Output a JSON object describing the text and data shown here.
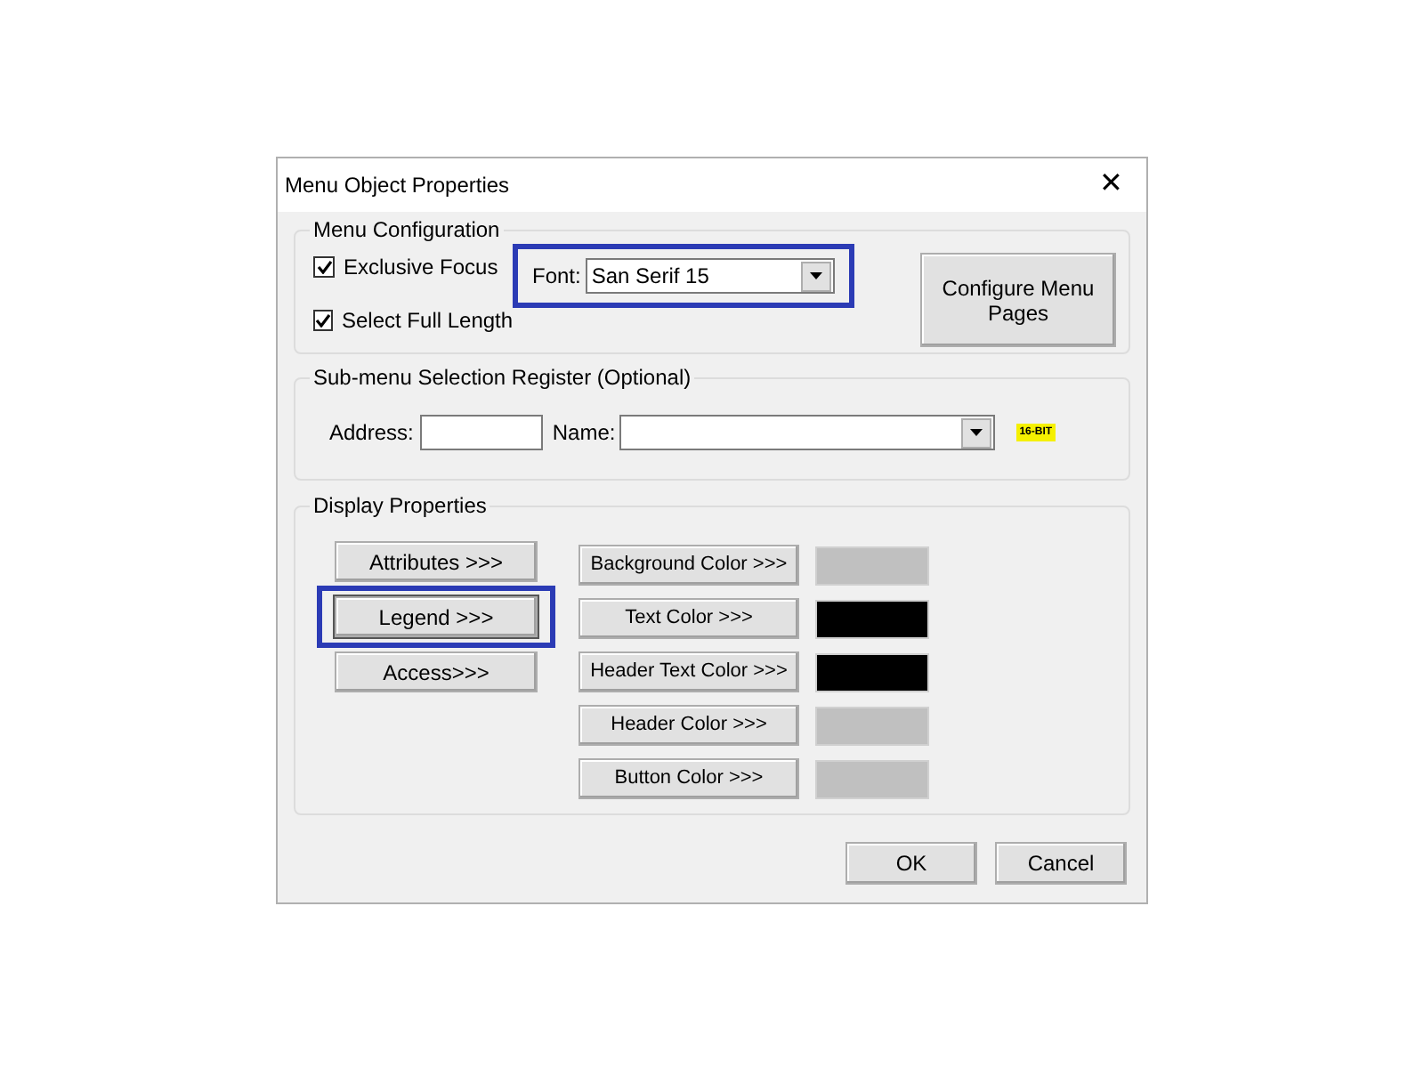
{
  "window": {
    "title": "Menu Object Properties",
    "close": "✕"
  },
  "menu_configuration": {
    "title": "Menu Configuration",
    "checkboxes": [
      {
        "label": "Exclusive Focus",
        "checked": true
      },
      {
        "label": "Select Full Length",
        "checked": true
      }
    ],
    "font": {
      "label": "Font:",
      "value": "San Serif 15",
      "highlighted": true
    },
    "configure_button": "Configure Menu Pages"
  },
  "submenu_register": {
    "title": "Sub-menu Selection Register (Optional)",
    "address_label": "Address:",
    "name_label": "Name:",
    "badge": "16-BIT"
  },
  "display_properties": {
    "title": "Display Properties",
    "buttons": [
      {
        "label": "Attributes >>>",
        "highlighted": false
      },
      {
        "label": "Legend >>>",
        "highlighted": true
      },
      {
        "label": "Access>>>",
        "highlighted": false
      }
    ],
    "color_buttons": [
      {
        "label": "Background Color >>>",
        "color": "#c0c0c0"
      },
      {
        "label": "Text Color >>>",
        "color": "#000000"
      },
      {
        "label": "Header Text Color >>>",
        "color": "#000000"
      },
      {
        "label": "Header Color >>>",
        "color": "#c0c0c0"
      },
      {
        "label": "Button Color >>>",
        "color": "#c0c0c0"
      }
    ]
  },
  "buttons": [
    "OK",
    "Cancel"
  ]
}
